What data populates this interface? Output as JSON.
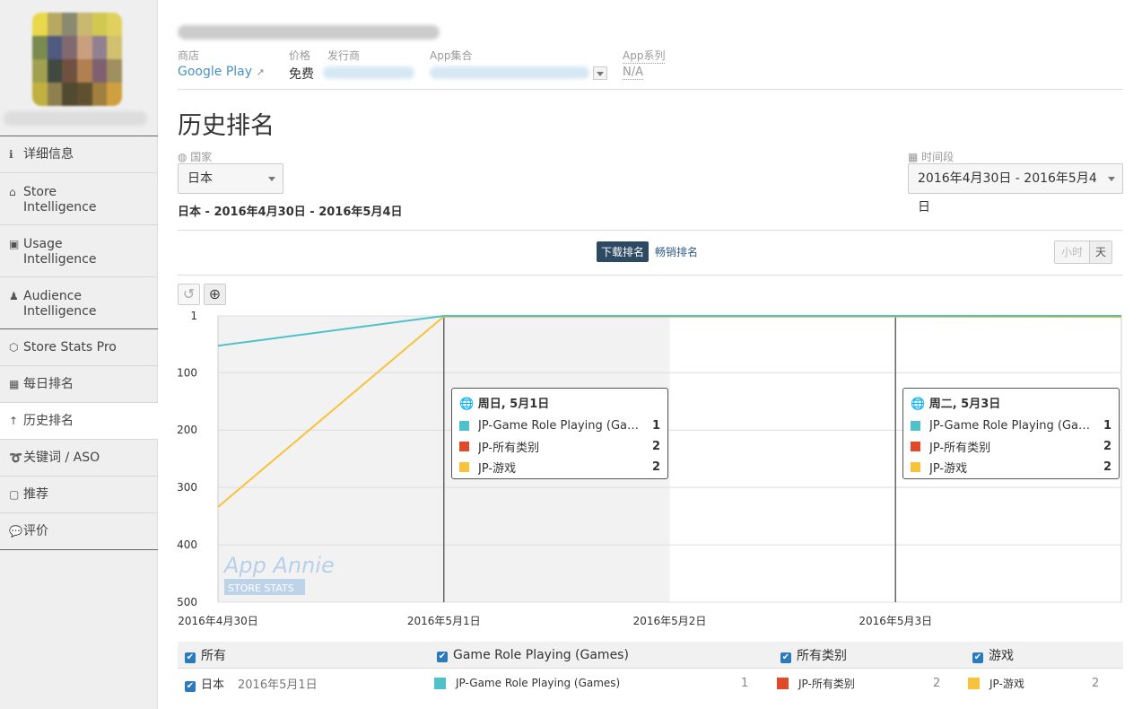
{
  "sidebar": {
    "logo_colors": [
      "#e8d84a",
      "#b8a860",
      "#8a8a70",
      "#c8b870",
      "#d0c850",
      "#e0d060",
      "#7a8a50",
      "#505a80",
      "#806a70",
      "#c8a080",
      "#908090",
      "#d0c070",
      "#a0a050",
      "#404a40",
      "#705040",
      "#b08050",
      "#806070",
      "#a09060",
      "#c0b040",
      "#908050",
      "#504a30",
      "#605030",
      "#a08040",
      "#d0a040"
    ],
    "items": [
      {
        "label": "详细信息",
        "icon": "info-icon",
        "glyph": "ℹ"
      },
      {
        "label": "Store Intelligence",
        "icon": "store-icon",
        "glyph": "⌂"
      },
      {
        "label": "Usage Intelligence",
        "icon": "usage-icon",
        "glyph": "▣"
      },
      {
        "label": "Audience Intelligence",
        "icon": "person-icon",
        "glyph": "♟"
      },
      {
        "label": "Store Stats Pro",
        "icon": "hexagon-icon",
        "glyph": "⬡"
      },
      {
        "label": "每日排名",
        "icon": "calendar-icon",
        "glyph": "▦"
      },
      {
        "label": "历史排名",
        "icon": "arrow-up-icon",
        "glyph": "↑"
      },
      {
        "label": "关键词 / ASO",
        "icon": "keyword-icon",
        "glyph": "➰"
      },
      {
        "label": "推荐",
        "icon": "feature-icon",
        "glyph": "▢"
      },
      {
        "label": "评价",
        "icon": "comment-icon",
        "glyph": "💬"
      }
    ]
  },
  "header": {
    "store_label": "商店",
    "store_value": "Google Play",
    "price_label": "价格",
    "price_value": "免费",
    "publisher_label": "发行商",
    "collection_label": "App集合",
    "series_label": "App系列",
    "series_value": "N/A"
  },
  "page_title": "历史排名",
  "filters": {
    "country_label": "国家",
    "country_value": "日本",
    "period_label": "时间段",
    "period_value": "2016年4月30日 - 2016年5月4日",
    "summary": "日本 - 2016年4月30日 - 2016年5月4日"
  },
  "tabs": {
    "downloads": "下载排名",
    "grossing": "畅销排名",
    "hour": "小时",
    "day": "天"
  },
  "chart_data": {
    "type": "line",
    "x": [
      "2016-04-30",
      "2016-05-01",
      "2016-05-02",
      "2016-05-03",
      "2016-05-04"
    ],
    "x_tick_labels": [
      "2016年4月30日",
      "2016年5月1日",
      "2016年5月2日",
      "2016年5月3日"
    ],
    "y_ticks": [
      1,
      100,
      200,
      300,
      400,
      500
    ],
    "ylim": [
      1,
      500
    ],
    "y_reversed": true,
    "grid": true,
    "series": [
      {
        "name": "JP-Game Role Playing (Games)",
        "color": "#4fc1c9",
        "values": [
          53,
          1,
          1,
          1,
          1
        ]
      },
      {
        "name": "JP-所有类别",
        "color": "#e04a2a",
        "values": [
          null,
          2,
          2,
          2,
          2
        ]
      },
      {
        "name": "JP-游戏",
        "color": "#f8c23a",
        "values": [
          334,
          2,
          2,
          2,
          3
        ]
      }
    ],
    "tooltips": [
      {
        "title": "周日, 5月1日",
        "rows": [
          {
            "name": "JP-Game Role Playing (Games...",
            "value": "1"
          },
          {
            "name": "JP-所有类别",
            "value": "2"
          },
          {
            "name": "JP-游戏",
            "value": "2"
          }
        ]
      },
      {
        "title": "周二, 5月3日",
        "rows": [
          {
            "name": "JP-Game Role Playing (Games...",
            "value": "1"
          },
          {
            "name": "JP-所有类别",
            "value": "2"
          },
          {
            "name": "JP-游戏",
            "value": "2"
          }
        ]
      }
    ],
    "watermark": "App Annie",
    "watermark_sub": "STORE STATS"
  },
  "legend": {
    "headers": [
      "所有",
      "Game Role Playing (Games)",
      "所有类别",
      "游戏"
    ],
    "row": {
      "country": "日本",
      "date": "2016年5月1日",
      "items": [
        {
          "name": "JP-Game Role Playing (Games)",
          "value": "1",
          "color": "#4fc1c9"
        },
        {
          "name": "JP-所有类别",
          "value": "2",
          "color": "#e04a2a"
        },
        {
          "name": "JP-游戏",
          "value": "2",
          "color": "#f8c23a"
        }
      ]
    }
  }
}
